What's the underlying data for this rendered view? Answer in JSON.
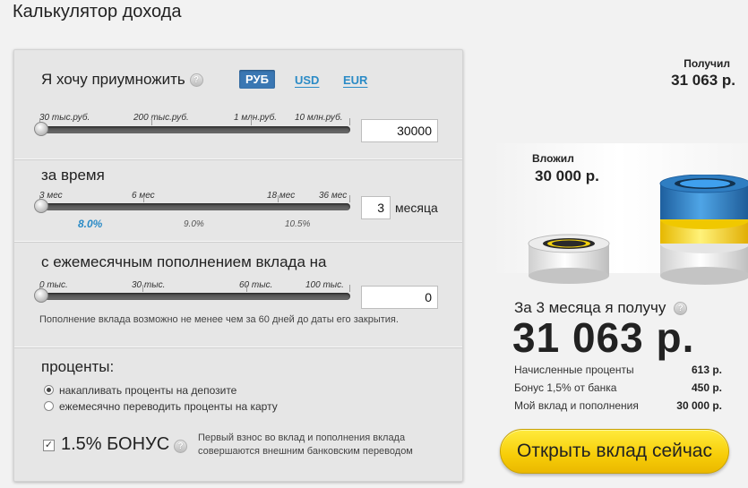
{
  "page": {
    "title": "Калькулятор дохода"
  },
  "amount": {
    "title": "Я хочу приумножить",
    "currencies": [
      "РУБ",
      "USD",
      "EUR"
    ],
    "selected_currency": "РУБ",
    "scale_labels": [
      "30 тыс.руб.",
      "200 тыс.руб.",
      "1 млн.руб.",
      "10 млн.руб."
    ],
    "value": "30000"
  },
  "term": {
    "title": "за время",
    "scale_labels": [
      "3 мес",
      "6 мес",
      "18 мес",
      "36 мес"
    ],
    "rates": [
      "8.0%",
      "9.0%",
      "10.5%"
    ],
    "value": "3",
    "unit": "месяца"
  },
  "topup": {
    "title": "с ежемесячным пополнением вклада на",
    "scale_labels": [
      "0 тыс.",
      "30 тыс.",
      "60 тыс.",
      "100 тыс."
    ],
    "value": "0",
    "note": "Пополнение вклада возможно не менее чем за 60 дней до даты его закрытия."
  },
  "interest": {
    "title": "проценты:",
    "options": [
      "накапливать проценты на депозите",
      "ежемесячно переводить проценты на карту"
    ],
    "selected_index": 0
  },
  "bonus": {
    "checked": true,
    "check_mark": "✓",
    "label": "1.5% БОНУС",
    "note": "Первый взнос во вклад и пополнения вклада совершаются внешним банковским переводом"
  },
  "result": {
    "received_label": "Получил",
    "received_value": "31 063 р.",
    "invested_label": "Вложил",
    "invested_value": "30 000 р.",
    "summary": "За 3 месяца я получу",
    "total": "31 063 р.",
    "breakdown": [
      {
        "label": "Начисленные проценты",
        "value": "613 р."
      },
      {
        "label": "Бонус 1,5% от банка",
        "value": "450 р."
      },
      {
        "label": "Мой вклад и пополнения",
        "value": "30 000 р."
      }
    ],
    "open_button": "Открыть вклад сейчас"
  },
  "colors": {
    "accent_blue": "#2b8bc6",
    "active_tab": "#3a77b3",
    "button_yellow": "#f7cd08"
  },
  "icons": [
    "help-icon",
    "slider-handle",
    "radio",
    "checkbox",
    "coin-stack"
  ]
}
